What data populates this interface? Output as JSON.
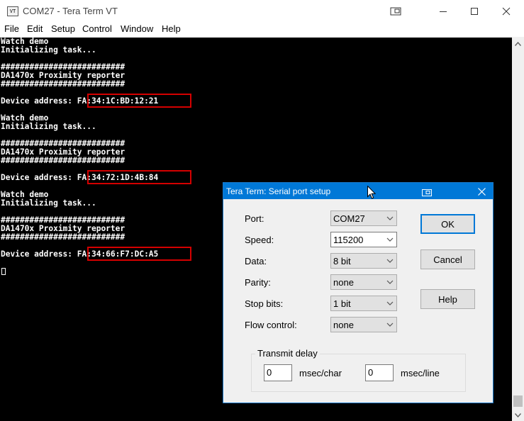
{
  "window": {
    "title": "COM27 - Tera Term VT",
    "icon_text": "VT"
  },
  "menu": [
    "File",
    "Edit",
    "Setup",
    "Control",
    "Window",
    "Help"
  ],
  "terminal": {
    "lines": [
      "Watch demo",
      "Initializing task...",
      "",
      "##########################",
      "DA1470x Proximity reporter",
      "##########################",
      "",
      "Device address: FA:34:1C:BD:12:21",
      "",
      "Watch demo",
      "Initializing task...",
      "",
      "##########################",
      "DA1470x Proximity reporter",
      "##########################",
      "",
      "Device address: FA:34:72:1D:4B:84",
      "",
      "Watch demo",
      "Initializing task...",
      "",
      "##########################",
      "DA1470x Proximity reporter",
      "##########################",
      "",
      "Device address: FA:34:66:F7:DC:A5"
    ],
    "highlight_color": "#d40000",
    "highlighted_addresses": [
      "FA:34:1C:BD:12:21",
      "FA:34:72:1D:4B:84",
      "FA:34:66:F7:DC:A5"
    ]
  },
  "dialog": {
    "title": "Tera Term: Serial port setup",
    "fields": [
      {
        "label": "Port:",
        "value": "COM27"
      },
      {
        "label": "Speed:",
        "value": "115200"
      },
      {
        "label": "Data:",
        "value": "8 bit"
      },
      {
        "label": "Parity:",
        "value": "none"
      },
      {
        "label": "Stop bits:",
        "value": "1 bit"
      },
      {
        "label": "Flow control:",
        "value": "none"
      }
    ],
    "buttons": {
      "ok": "OK",
      "cancel": "Cancel",
      "help": "Help"
    },
    "transmit_delay": {
      "label": "Transmit delay",
      "char_value": "0",
      "char_unit": "msec/char",
      "line_value": "0",
      "line_unit": "msec/line"
    },
    "accent_color": "#0078d7"
  }
}
